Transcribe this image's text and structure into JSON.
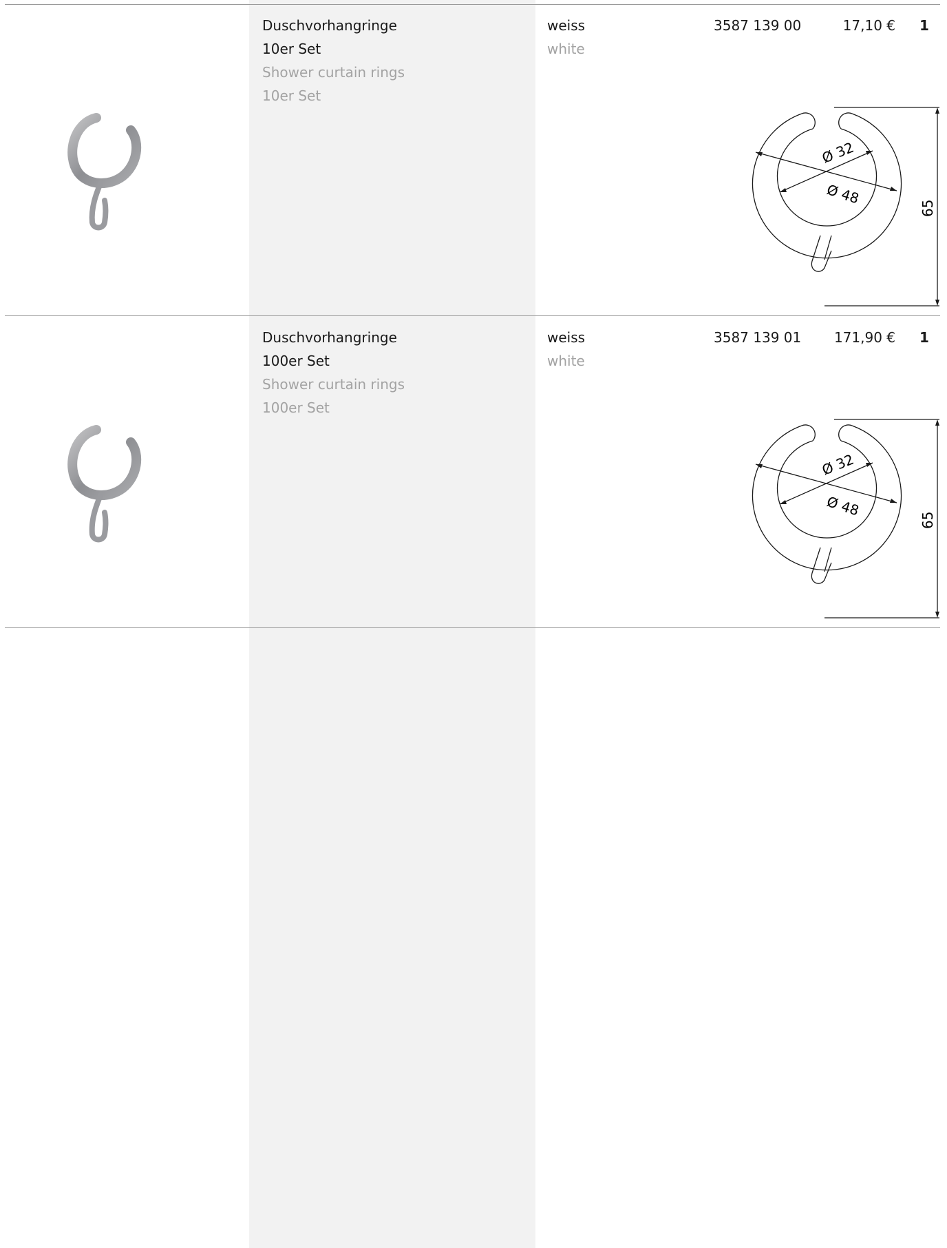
{
  "products": [
    {
      "name_de": "Duschvorhangringe",
      "set_de": "10er Set",
      "name_en": "Shower curtain rings",
      "set_en": "10er Set",
      "color_de": "weiss",
      "color_en": "white",
      "article_no": "3587 139 00",
      "price": "17,10 €",
      "quantity": "1",
      "drawing": {
        "inner_diameter": "Ø 32",
        "outer_diameter": "Ø 48",
        "height": "65"
      }
    },
    {
      "name_de": "Duschvorhangringe",
      "set_de": "100er Set",
      "name_en": "Shower curtain rings",
      "set_en": "100er Set",
      "color_de": "weiss",
      "color_en": "white",
      "article_no": "3587 139 01",
      "price": "171,90 €",
      "quantity": "1",
      "drawing": {
        "inner_diameter": "Ø 32",
        "outer_diameter": "Ø 48",
        "height": "65"
      }
    }
  ],
  "colors": {
    "secondary_text": "#a3a3a3",
    "column_shade": "#f2f2f2",
    "rule": "#9a9a9a"
  }
}
